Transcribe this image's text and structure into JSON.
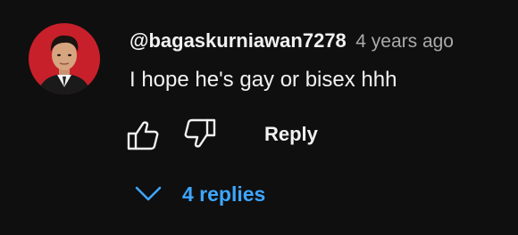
{
  "comment": {
    "author": "@bagaskurniawan7278",
    "timestamp": "4 years ago",
    "text": "I hope he's gay or bisex hhh",
    "avatar": "user-avatar-photo",
    "actions": {
      "like_icon": "thumbs-up-icon",
      "dislike_icon": "thumbs-down-icon",
      "reply_label": "Reply"
    },
    "replies": {
      "icon": "chevron-down-icon",
      "label": "4 replies"
    }
  },
  "colors": {
    "background": "#0f0f0f",
    "primary_text": "#f1f1f1",
    "secondary_text": "#aaaaaa",
    "link": "#3ea6ff",
    "avatar_bg": "#c8202a"
  }
}
